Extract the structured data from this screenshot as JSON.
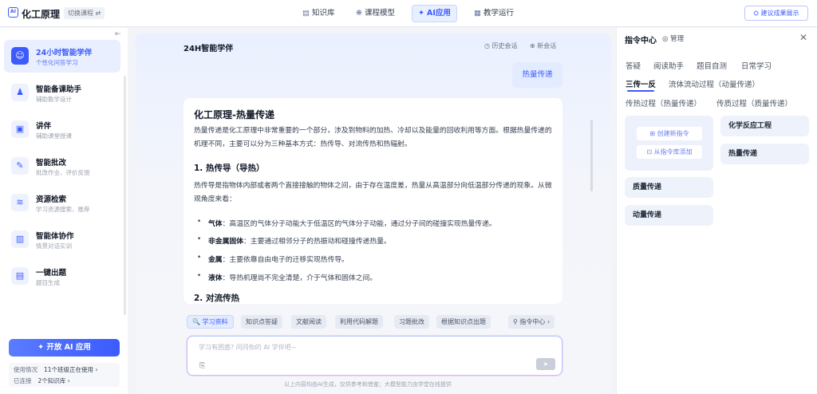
{
  "topbar": {
    "logo": "AI",
    "app_title": "化工原理",
    "switch_course": "切换课程 ⇄",
    "nav": [
      {
        "label": "知识库",
        "icon": "▤"
      },
      {
        "label": "课程模型",
        "icon": "❋"
      },
      {
        "label": "AI应用",
        "icon": "✦"
      },
      {
        "label": "教学运行",
        "icon": "▦"
      }
    ],
    "suggest_button": "⛭ 建议成果展示"
  },
  "sidebar": {
    "items": [
      {
        "title": "24小时智能学伴",
        "subtitle": "个性化问答学习",
        "icon": "☺"
      },
      {
        "title": "智能备课助手",
        "subtitle": "辅助教学设计",
        "icon": "♟"
      },
      {
        "title": "讲伴",
        "subtitle": "辅助课堂授课",
        "icon": "▣"
      },
      {
        "title": "智能批改",
        "subtitle": "批改作业、评价反馈",
        "icon": "✎"
      },
      {
        "title": "资源检索",
        "subtitle": "学习资源搜索、推荐",
        "icon": "≋"
      },
      {
        "title": "智能体协作",
        "subtitle": "情景对话实训",
        "icon": "▥"
      },
      {
        "title": "一键出题",
        "subtitle": "题目生成",
        "icon": "▤"
      }
    ],
    "open_ai": "✦ 开放 AI 应用",
    "usage": {
      "label1": "使用情况",
      "value1": "11个班级正在使用 ›",
      "label2": "已连接",
      "value2": "2个知识库 ›"
    }
  },
  "chat": {
    "title": "24H智能学伴",
    "history": "◷ 历史会话",
    "new_chat": "⊕ 新会话",
    "user_message": "热量传递",
    "answer": {
      "h1": "化工原理-热量传递",
      "intro": "热量传递是化工原理中非常重要的一个部分，涉及到物料的加热、冷却以及能量的回收利用等方面。根据热量传递的机理不同，主要可以分为三种基本方式：热传导、对流传热和热辐射。",
      "s1_title": "1. 热传导（导热）",
      "s1_text": "热传导是指物体内部或者两个直接接触的物体之间，由于存在温度差，热量从高温部分向低温部分传递的现象。从微观角度来看：",
      "bullets": [
        {
          "term": "气体",
          "text": "：高温区的气体分子动能大于低温区的气体分子动能，通过分子间的碰撞实现热量传递。"
        },
        {
          "term": "非金属固体",
          "text": "：主要通过相邻分子的热振动和碰撞传递热量。"
        },
        {
          "term": "金属",
          "text": "：主要依靠自由电子的迁移实现热传导。"
        },
        {
          "term": "液体",
          "text": "：导热机理尚不完全清楚，介于气体和固体之间。"
        }
      ],
      "s2_title": "2. 对流传热"
    },
    "chips": [
      "🔍 学习资料",
      "知识点答疑",
      "文献阅读",
      "利用代码解题",
      "习题批改",
      "根据知识点出题",
      "⚲ 指令中心 ›"
    ],
    "input_placeholder": "学习有困惑? 问问你的 AI 学伴吧~",
    "attach_icon": "⎘",
    "send_icon": "➤",
    "footer": "以上内容均由AI生成，仅供参考和借鉴；大模型能力由学堂在线提供"
  },
  "right_panel": {
    "title": "指令中心",
    "manage": "◎ 管理",
    "close": "✕",
    "tabs_row1": [
      "答疑",
      "阅读助手",
      "题目自测",
      "日常学习"
    ],
    "tabs_row2": [
      "三传一反",
      "流体流动过程（动量传递）"
    ],
    "tabs_row3": [
      "传热过程（热量传递）",
      "传质过程（质量传递）"
    ],
    "create_new": "⊞ 创建新指令",
    "from_library": "⊡ 从指令库添加",
    "cards": [
      "化学反应工程",
      "热量传递",
      "质量传递",
      "动量传递"
    ]
  }
}
